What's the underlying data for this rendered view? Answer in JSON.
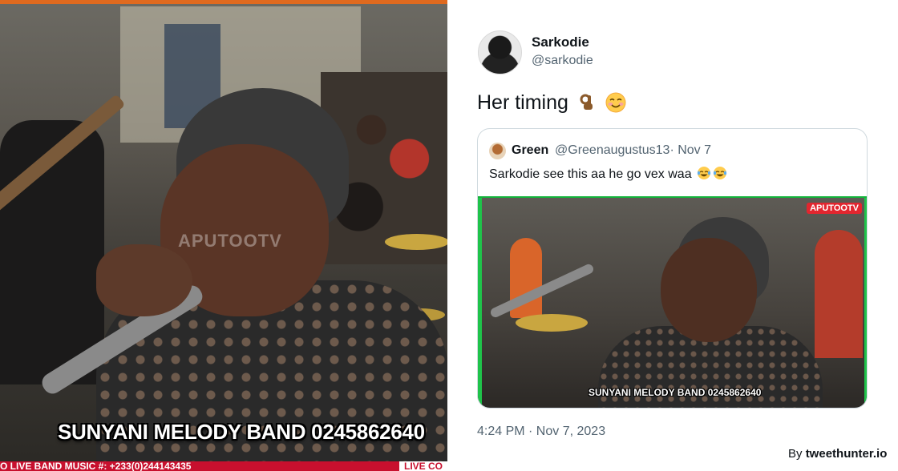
{
  "left_video": {
    "watermark": "APUTOOTV",
    "band_caption": "SUNYANI MELODY BAND 0245862640",
    "ticker_left": "O LIVE BAND MUSIC  #: +233(0)244143435",
    "ticker_right": "LIVE  CO"
  },
  "tweet": {
    "author_name": "Sarkodie",
    "author_handle": "@sarkodie",
    "text": "Her timing",
    "emojis": [
      "ok-hand-icon",
      "smiling-face-icon"
    ],
    "quote": {
      "name": "Green",
      "handle_date": "@Greenaugustus13· Nov 7",
      "text": "Sarkodie see this aa he go vex waa",
      "emojis": [
        "laughing-tears-icon",
        "laughing-tears-icon"
      ],
      "video": {
        "logo": "APUTOOTV",
        "band_caption": "SUNYANI MELODY BAND 0245862640"
      }
    },
    "timestamp": "4:24 PM · Nov 7, 2023"
  },
  "branding": {
    "prefix": "By",
    "name": "tweethunter.io"
  },
  "colors": {
    "ticker_red": "#c8102e",
    "video_green_border": "#1fc34a",
    "text_primary": "#0f1419",
    "text_secondary": "#536471",
    "card_border": "#cfd9de"
  }
}
